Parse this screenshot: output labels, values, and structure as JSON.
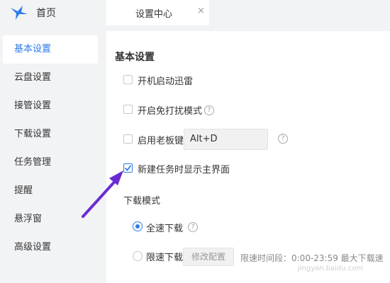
{
  "header": {
    "home_label": "首页",
    "tab_label": "设置中心",
    "tab_close": "×"
  },
  "sidebar": {
    "items": [
      {
        "label": "基本设置",
        "active": true
      },
      {
        "label": "云盘设置",
        "active": false
      },
      {
        "label": "接管设置",
        "active": false
      },
      {
        "label": "下载设置",
        "active": false
      },
      {
        "label": "任务管理",
        "active": false
      },
      {
        "label": "提醒",
        "active": false
      },
      {
        "label": "悬浮窗",
        "active": false
      },
      {
        "label": "高级设置",
        "active": false
      }
    ]
  },
  "main": {
    "section_title": "基本设置",
    "options": [
      {
        "label": "开机启动迅雷",
        "checked": false
      },
      {
        "label": "开启免打扰模式",
        "checked": false
      },
      {
        "label": "启用老板键",
        "checked": false
      },
      {
        "label": "新建任务时显示主界面",
        "checked": true
      }
    ],
    "help_glyph": "?",
    "hotkey_value": "Alt+D",
    "download_mode": {
      "title": "下载模式",
      "full_speed_label": "全速下载",
      "limit_label": "限速下载",
      "modify_button": "修改配置",
      "limit_period_text": "限速时间段：0:00-23:59 最大下载速"
    }
  },
  "watermark": "jingyan.baidu.com",
  "colors": {
    "accent": "#2b7ce9",
    "annotation_arrow": "#6b2bd3",
    "sidebar_bg": "#f2f3f5",
    "content_bg": "#ffffff"
  }
}
